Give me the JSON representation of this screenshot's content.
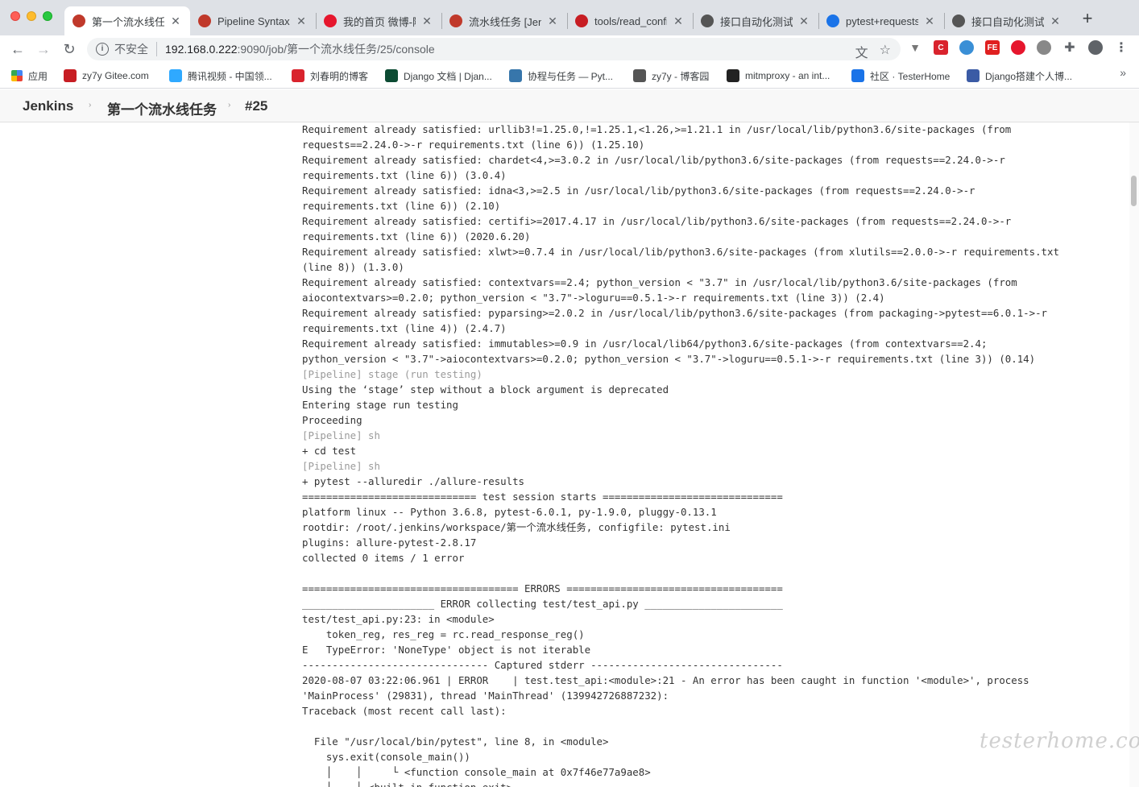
{
  "browser": {
    "tabs": [
      {
        "title": "第一个流水线任务",
        "icon_color": "#c0392b",
        "active": true
      },
      {
        "title": "Pipeline Syntax",
        "icon_color": "#c0392b",
        "active": false
      },
      {
        "title": "我的首页 微博-随",
        "icon_color": "#e6162d",
        "active": false
      },
      {
        "title": "流水线任务 [Jen",
        "icon_color": "#c0392b",
        "active": false
      },
      {
        "title": "tools/read_confi",
        "icon_color": "#c71d23",
        "active": false
      },
      {
        "title": "接口自动化测试与",
        "icon_color": "#555555",
        "active": false
      },
      {
        "title": "pytest+requests",
        "icon_color": "#1a73e8",
        "active": false
      },
      {
        "title": "接口自动化测试与",
        "icon_color": "#555555",
        "active": false
      }
    ],
    "tab_close": "✕",
    "new_tab": "+",
    "omnibox": {
      "insecure_label": "不安全",
      "url_host": "192.168.0.222",
      "url_path": ":9090/job/第一个流水线任务/25/console"
    },
    "bookmarks": [
      {
        "label": "应用",
        "icon": "apps-grid-icon"
      },
      {
        "label": "zy7y Gitee.com",
        "icon": "gitee-icon",
        "color": "#c71d23"
      },
      {
        "label": "腾讯视频 - 中国领...",
        "icon": "tencent-video-icon",
        "color": "#2fa9ff"
      },
      {
        "label": "刘春明的博客",
        "icon": "csdn-icon",
        "color": "#d9232d"
      },
      {
        "label": "Django 文档 | Djan...",
        "icon": "django-icon",
        "color": "#0c4b33"
      },
      {
        "label": "协程与任务 — Pyt...",
        "icon": "python-icon",
        "color": "#3776ab"
      },
      {
        "label": "zy7y - 博客园",
        "icon": "cnblogs-icon",
        "color": "#555555"
      },
      {
        "label": "mitmproxy - an int...",
        "icon": "mitmproxy-icon",
        "color": "#222222"
      },
      {
        "label": "社区 · TesterHome",
        "icon": "testerhome-icon",
        "color": "#1a73e8"
      },
      {
        "label": "Django搭建个人博...",
        "icon": "django-blog-icon",
        "color": "#3b5ba5"
      }
    ]
  },
  "jenkins": {
    "breadcrumbs": [
      "Jenkins",
      "第一个流水线任务",
      "#25"
    ]
  },
  "console_lines": [
    {
      "text": "Requirement already satisfied: urllib3!=1.25.0,!=1.25.1,<1.26,>=1.21.1 in /usr/local/lib/python3.6/site-packages (from",
      "kind": "normal"
    },
    {
      "text": "requests==2.24.0->-r requirements.txt (line 6)) (1.25.10)",
      "kind": "normal"
    },
    {
      "text": "Requirement already satisfied: chardet<4,>=3.0.2 in /usr/local/lib/python3.6/site-packages (from requests==2.24.0->-r",
      "kind": "normal"
    },
    {
      "text": "requirements.txt (line 6)) (3.0.4)",
      "kind": "normal"
    },
    {
      "text": "Requirement already satisfied: idna<3,>=2.5 in /usr/local/lib/python3.6/site-packages (from requests==2.24.0->-r",
      "kind": "normal"
    },
    {
      "text": "requirements.txt (line 6)) (2.10)",
      "kind": "normal"
    },
    {
      "text": "Requirement already satisfied: certifi>=2017.4.17 in /usr/local/lib/python3.6/site-packages (from requests==2.24.0->-r",
      "kind": "normal"
    },
    {
      "text": "requirements.txt (line 6)) (2020.6.20)",
      "kind": "normal"
    },
    {
      "text": "Requirement already satisfied: xlwt>=0.7.4 in /usr/local/lib/python3.6/site-packages (from xlutils==2.0.0->-r requirements.txt",
      "kind": "normal"
    },
    {
      "text": "(line 8)) (1.3.0)",
      "kind": "normal"
    },
    {
      "text": "Requirement already satisfied: contextvars==2.4; python_version < \"3.7\" in /usr/local/lib/python3.6/site-packages (from",
      "kind": "normal"
    },
    {
      "text": "aiocontextvars>=0.2.0; python_version < \"3.7\"->loguru==0.5.1->-r requirements.txt (line 3)) (2.4)",
      "kind": "normal"
    },
    {
      "text": "Requirement already satisfied: pyparsing>=2.0.2 in /usr/local/lib/python3.6/site-packages (from packaging->pytest==6.0.1->-r",
      "kind": "normal"
    },
    {
      "text": "requirements.txt (line 4)) (2.4.7)",
      "kind": "normal"
    },
    {
      "text": "Requirement already satisfied: immutables>=0.9 in /usr/local/lib64/python3.6/site-packages (from contextvars==2.4;",
      "kind": "normal"
    },
    {
      "text": "python_version < \"3.7\"->aiocontextvars>=0.2.0; python_version < \"3.7\"->loguru==0.5.1->-r requirements.txt (line 3)) (0.14)",
      "kind": "normal"
    },
    {
      "text": "[Pipeline] stage (run testing)",
      "kind": "pipeline"
    },
    {
      "text": "Using the ‘stage’ step without a block argument is deprecated",
      "kind": "normal"
    },
    {
      "text": "Entering stage run testing",
      "kind": "normal"
    },
    {
      "text": "Proceeding",
      "kind": "normal"
    },
    {
      "text": "[Pipeline] sh",
      "kind": "pipeline"
    },
    {
      "text": "+ cd test",
      "kind": "normal"
    },
    {
      "text": "[Pipeline] sh",
      "kind": "pipeline"
    },
    {
      "text": "+ pytest --alluredir ./allure-results",
      "kind": "normal"
    },
    {
      "text": "============================= test session starts ==============================",
      "kind": "normal"
    },
    {
      "text": "platform linux -- Python 3.6.8, pytest-6.0.1, py-1.9.0, pluggy-0.13.1",
      "kind": "normal"
    },
    {
      "text": "rootdir: /root/.jenkins/workspace/第一个流水线任务, configfile: pytest.ini",
      "kind": "normal"
    },
    {
      "text": "plugins: allure-pytest-2.8.17",
      "kind": "normal"
    },
    {
      "text": "collected 0 items / 1 error",
      "kind": "normal"
    },
    {
      "text": "",
      "kind": "normal"
    },
    {
      "text": "==================================== ERRORS ====================================",
      "kind": "normal"
    },
    {
      "text": "______________________ ERROR collecting test/test_api.py _______________________",
      "kind": "normal"
    },
    {
      "text": "test/test_api.py:23: in <module>",
      "kind": "normal"
    },
    {
      "text": "    token_reg, res_reg = rc.read_response_reg()",
      "kind": "normal"
    },
    {
      "text": "E   TypeError: 'NoneType' object is not iterable",
      "kind": "normal"
    },
    {
      "text": "------------------------------- Captured stderr --------------------------------",
      "kind": "normal"
    },
    {
      "text": "2020-08-07 03:22:06.961 | ERROR    | test.test_api:<module>:21 - An error has been caught in function '<module>', process",
      "kind": "normal"
    },
    {
      "text": "'MainProcess' (29831), thread 'MainThread' (139942726887232):",
      "kind": "normal"
    },
    {
      "text": "Traceback (most recent call last):",
      "kind": "normal"
    },
    {
      "text": "",
      "kind": "normal"
    },
    {
      "text": "  File \"/usr/local/bin/pytest\", line 8, in <module>",
      "kind": "normal"
    },
    {
      "text": "    sys.exit(console_main())",
      "kind": "normal"
    },
    {
      "text": "    │    │     └ <function console_main at 0x7f46e77a9ae8>",
      "kind": "normal"
    },
    {
      "text": "    │    └ <built-in function exit>",
      "kind": "normal"
    }
  ],
  "watermark": "testerhome.com"
}
